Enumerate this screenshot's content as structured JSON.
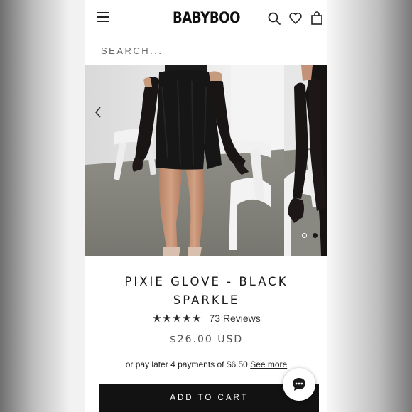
{
  "brand": {
    "logo_text": "BABYBOO"
  },
  "search": {
    "placeholder": "SEARCH..."
  },
  "gallery": {
    "slide_count": 2,
    "active_slide": 2
  },
  "product": {
    "title": "PIXIE GLOVE - BLACK SPARKLE",
    "rating_stars": 5,
    "reviews_label": "73 Reviews",
    "price": "$26.00 USD",
    "payment_text": "or pay later 4 payments of $6.50",
    "payment_link": "See more",
    "add_to_cart": "ADD TO CART"
  },
  "icons": {
    "menu": "menu-icon",
    "search": "search-icon",
    "wishlist": "heart-icon",
    "cart": "shopping-bag-icon",
    "prev": "chevron-left-icon",
    "chat": "chat-bubble-icon"
  },
  "colors": {
    "button_bg": "#121212",
    "text": "#1a1a1a",
    "price": "#555555"
  }
}
